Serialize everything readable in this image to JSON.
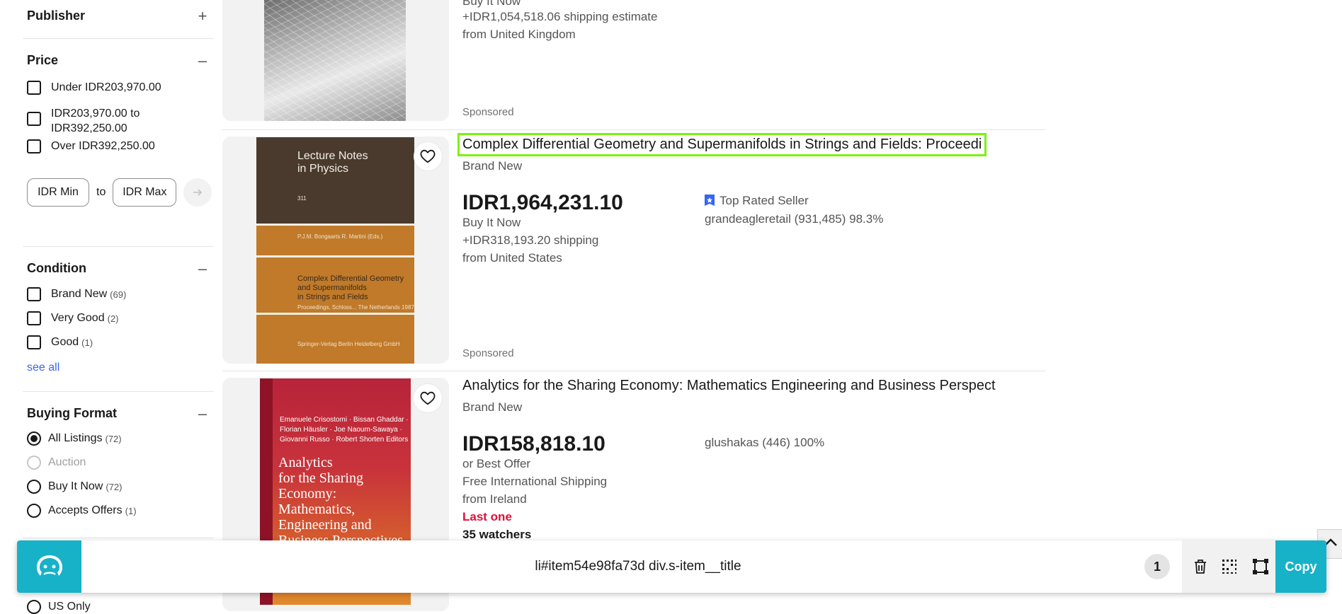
{
  "sidebar": {
    "publisher": {
      "label": "Publisher",
      "toggle": "+"
    },
    "price": {
      "label": "Price",
      "toggle": "–",
      "options": [
        {
          "label": "Under IDR203,970.00"
        },
        {
          "label": "IDR203,970.00 to IDR392,250.00"
        },
        {
          "label": "Over IDR392,250.00"
        }
      ],
      "min_placeholder": "IDR Min",
      "to_label": "to",
      "max_placeholder": "IDR Max",
      "go_icon": "→"
    },
    "condition": {
      "label": "Condition",
      "toggle": "–",
      "options": [
        {
          "label": "Brand New",
          "count": "(69)"
        },
        {
          "label": "Very Good",
          "count": "(2)"
        },
        {
          "label": "Good",
          "count": "(1)"
        }
      ],
      "see_all": "see all"
    },
    "buying_format": {
      "label": "Buying Format",
      "toggle": "–",
      "options": [
        {
          "label": "All Listings",
          "count": "(72)",
          "selected": true
        },
        {
          "label": "Auction",
          "count": "",
          "disabled": true
        },
        {
          "label": "Buy It Now",
          "count": "(72)"
        },
        {
          "label": "Accepts Offers",
          "count": "(1)"
        }
      ]
    },
    "item_location_partial": "US Only"
  },
  "listings": [
    {
      "buy_format": "Buy It Now",
      "shipping": "+IDR1,054,518.06 shipping estimate",
      "location": "from United Kingdom",
      "sponsored": "Sponsored"
    },
    {
      "title": "Complex Differential Geometry and Supermanifolds in Strings and Fields: Proceedi",
      "condition": "Brand New",
      "price": "IDR1,964,231.10",
      "buy_format": "Buy It Now",
      "shipping": "+IDR318,193.20 shipping",
      "location": "from United States",
      "badge": "Top Rated Seller",
      "seller": "grandeagleretail (931,485) 98.3%",
      "sponsored": "Sponsored",
      "cover": {
        "series": "Lecture Notes in Physics",
        "series_line1": "Lecture Notes",
        "series_line2": "in Physics",
        "number": "311",
        "editors": "P.J.M. Bongaarts  R. Martini (Eds.)",
        "title_line1": "Complex Differential Geometry",
        "title_line2": "and Supermanifolds",
        "title_line3": "in Strings and Fields",
        "subtitle": "Proceedings, Schloss... The Netherlands 1987",
        "publisher": "Springer-Verlag Berlin Heidelberg GmbH"
      }
    },
    {
      "title": "Analytics for the Sharing Economy: Mathematics Engineering and Business Perspect",
      "condition": "Brand New",
      "price": "IDR158,818.10",
      "buy_format": "or Best Offer",
      "shipping": "Free International Shipping",
      "location": "from Ireland",
      "last_one": "Last one",
      "watchers": "35 watchers",
      "seller": "glushakas (446) 100%",
      "cover": {
        "authors_line1": "Emanuele Crisostomi · Bissan Ghaddar ·",
        "authors_line2": "Florian Häusler · Joe Naoum-Sawaya ·",
        "authors_line3": "Giovanni Russo · Robert Shorten  Editors",
        "title_line1": "Analytics",
        "title_line2": "for the Sharing",
        "title_line3": "Economy:",
        "title_line4": "Mathematics,",
        "title_line5": "Engineering and",
        "title_line6": "Business Perspectives"
      }
    }
  ],
  "toolbar": {
    "selector": "li#item54e98fa73d div.s-item__title",
    "match_count": "1",
    "copy_label": "Copy",
    "icons": [
      "logo-icon",
      "trash-icon",
      "grid-icon",
      "select-frame-icon"
    ]
  },
  "colors": {
    "accent": "#17b2c7",
    "highlight": "#7cf20f",
    "link": "#3665f3",
    "alert": "#e0103a",
    "top_rated_badge": "#3665f3"
  }
}
